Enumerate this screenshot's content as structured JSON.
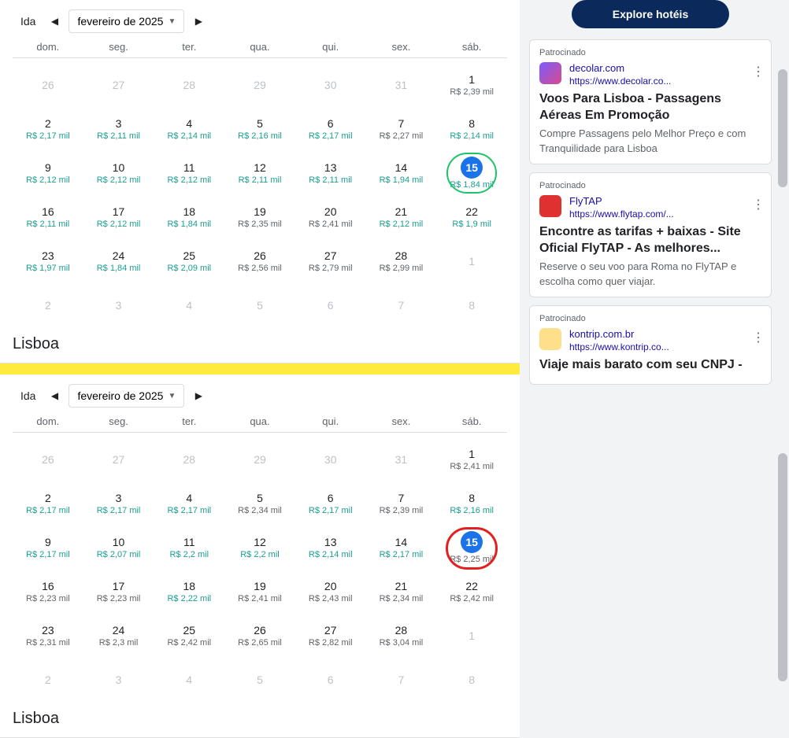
{
  "explore_button": "Explore hotéis",
  "calendars": [
    {
      "ida_label": "Ida",
      "month_label": "fevereiro de 2025",
      "weekdays": [
        "dom.",
        "seg.",
        "ter.",
        "qua.",
        "qui.",
        "sex.",
        "sáb."
      ],
      "dest_title": "Lisboa",
      "circle_style": "green",
      "days": [
        {
          "num": "26",
          "muted": true
        },
        {
          "num": "27",
          "muted": true
        },
        {
          "num": "28",
          "muted": true
        },
        {
          "num": "29",
          "muted": true
        },
        {
          "num": "30",
          "muted": true
        },
        {
          "num": "31",
          "muted": true
        },
        {
          "num": "1",
          "price": "R$ 2,39 mil",
          "price_alt": true
        },
        {
          "num": "2",
          "price": "R$ 2,17 mil"
        },
        {
          "num": "3",
          "price": "R$ 2,11 mil"
        },
        {
          "num": "4",
          "price": "R$ 2,14 mil"
        },
        {
          "num": "5",
          "price": "R$ 2,16 mil"
        },
        {
          "num": "6",
          "price": "R$ 2,17 mil"
        },
        {
          "num": "7",
          "price": "R$ 2,27 mil",
          "price_alt": true
        },
        {
          "num": "8",
          "price": "R$ 2,14 mil"
        },
        {
          "num": "9",
          "price": "R$ 2,12 mil"
        },
        {
          "num": "10",
          "price": "R$ 2,12 mil"
        },
        {
          "num": "11",
          "price": "R$ 2,12 mil"
        },
        {
          "num": "12",
          "price": "R$ 2,11 mil"
        },
        {
          "num": "13",
          "price": "R$ 2,11 mil"
        },
        {
          "num": "14",
          "price": "R$ 1,94 mil"
        },
        {
          "num": "15",
          "price": "R$ 1,84 mil",
          "selected": true,
          "circle": true
        },
        {
          "num": "16",
          "price": "R$ 2,11 mil"
        },
        {
          "num": "17",
          "price": "R$ 2,12 mil"
        },
        {
          "num": "18",
          "price": "R$ 1,84 mil"
        },
        {
          "num": "19",
          "price": "R$ 2,35 mil",
          "price_alt": true
        },
        {
          "num": "20",
          "price": "R$ 2,41 mil",
          "price_alt": true
        },
        {
          "num": "21",
          "price": "R$ 2,12 mil"
        },
        {
          "num": "22",
          "price": "R$ 1,9 mil"
        },
        {
          "num": "23",
          "price": "R$ 1,97 mil"
        },
        {
          "num": "24",
          "price": "R$ 1,84 mil"
        },
        {
          "num": "25",
          "price": "R$ 2,09 mil"
        },
        {
          "num": "26",
          "price": "R$ 2,56 mil",
          "price_alt": true
        },
        {
          "num": "27",
          "price": "R$ 2,79 mil",
          "price_alt": true
        },
        {
          "num": "28",
          "price": "R$ 2,99 mil",
          "price_alt": true
        },
        {
          "num": "1",
          "muted": true
        },
        {
          "num": "2",
          "muted": true
        },
        {
          "num": "3",
          "muted": true
        },
        {
          "num": "4",
          "muted": true
        },
        {
          "num": "5",
          "muted": true
        },
        {
          "num": "6",
          "muted": true
        },
        {
          "num": "7",
          "muted": true
        },
        {
          "num": "8",
          "muted": true
        }
      ]
    },
    {
      "ida_label": "Ida",
      "month_label": "fevereiro de 2025",
      "weekdays": [
        "dom.",
        "seg.",
        "ter.",
        "qua.",
        "qui.",
        "sex.",
        "sáb."
      ],
      "dest_title": "Lisboa",
      "circle_style": "red",
      "days": [
        {
          "num": "26",
          "muted": true
        },
        {
          "num": "27",
          "muted": true
        },
        {
          "num": "28",
          "muted": true
        },
        {
          "num": "29",
          "muted": true
        },
        {
          "num": "30",
          "muted": true
        },
        {
          "num": "31",
          "muted": true
        },
        {
          "num": "1",
          "price": "R$ 2,41 mil",
          "price_alt": true
        },
        {
          "num": "2",
          "price": "R$ 2,17 mil"
        },
        {
          "num": "3",
          "price": "R$ 2,17 mil"
        },
        {
          "num": "4",
          "price": "R$ 2,17 mil"
        },
        {
          "num": "5",
          "price": "R$ 2,34 mil",
          "price_alt": true
        },
        {
          "num": "6",
          "price": "R$ 2,17 mil"
        },
        {
          "num": "7",
          "price": "R$ 2,39 mil",
          "price_alt": true
        },
        {
          "num": "8",
          "price": "R$ 2,16 mil"
        },
        {
          "num": "9",
          "price": "R$ 2,17 mil"
        },
        {
          "num": "10",
          "price": "R$ 2,07 mil"
        },
        {
          "num": "11",
          "price": "R$ 2,2 mil"
        },
        {
          "num": "12",
          "price": "R$ 2,2 mil"
        },
        {
          "num": "13",
          "price": "R$ 2,14 mil"
        },
        {
          "num": "14",
          "price": "R$ 2,17 mil"
        },
        {
          "num": "15",
          "price": "R$ 2,25 mil",
          "selected": true,
          "circle": true,
          "price_alt": true
        },
        {
          "num": "16",
          "price": "R$ 2,23 mil",
          "price_alt": true
        },
        {
          "num": "17",
          "price": "R$ 2,23 mil",
          "price_alt": true
        },
        {
          "num": "18",
          "price": "R$ 2,22 mil"
        },
        {
          "num": "19",
          "price": "R$ 2,41 mil",
          "price_alt": true
        },
        {
          "num": "20",
          "price": "R$ 2,43 mil",
          "price_alt": true
        },
        {
          "num": "21",
          "price": "R$ 2,34 mil",
          "price_alt": true
        },
        {
          "num": "22",
          "price": "R$ 2,42 mil",
          "price_alt": true
        },
        {
          "num": "23",
          "price": "R$ 2,31 mil",
          "price_alt": true
        },
        {
          "num": "24",
          "price": "R$ 2,3 mil",
          "price_alt": true
        },
        {
          "num": "25",
          "price": "R$ 2,42 mil",
          "price_alt": true
        },
        {
          "num": "26",
          "price": "R$ 2,65 mil",
          "price_alt": true
        },
        {
          "num": "27",
          "price": "R$ 2,82 mil",
          "price_alt": true
        },
        {
          "num": "28",
          "price": "R$ 3,04 mil",
          "price_alt": true
        },
        {
          "num": "1",
          "muted": true
        },
        {
          "num": "2",
          "muted": true
        },
        {
          "num": "3",
          "muted": true
        },
        {
          "num": "4",
          "muted": true
        },
        {
          "num": "5",
          "muted": true
        },
        {
          "num": "6",
          "muted": true
        },
        {
          "num": "7",
          "muted": true
        },
        {
          "num": "8",
          "muted": true
        }
      ]
    }
  ],
  "ads": [
    {
      "sponsored": "Patrocinado",
      "icon_bg": "linear-gradient(135deg,#7b5cff,#d94a8c)",
      "domain": "decolar.com",
      "url": "https://www.decolar.co...",
      "title": "Voos Para Lisboa - Passagens Aéreas Em Promoção",
      "desc": "Compre Passagens pelo Melhor Preço e com Tranquilidade para Lisboa"
    },
    {
      "sponsored": "Patrocinado",
      "icon_bg": "#e03131",
      "domain": "FlyTAP",
      "url": "https://www.flytap.com/...",
      "title": "Encontre as tarifas + baixas - Site Oficial FlyTAP - As melhores...",
      "desc": "Reserve o seu voo para Roma no FlyTAP e escolha como quer viajar."
    },
    {
      "sponsored": "Patrocinado",
      "icon_bg": "#ffe08a",
      "domain": "kontrip.com.br",
      "url": "https://www.kontrip.co...",
      "title": "Viaje mais barato com seu CNPJ -",
      "desc": ""
    }
  ]
}
